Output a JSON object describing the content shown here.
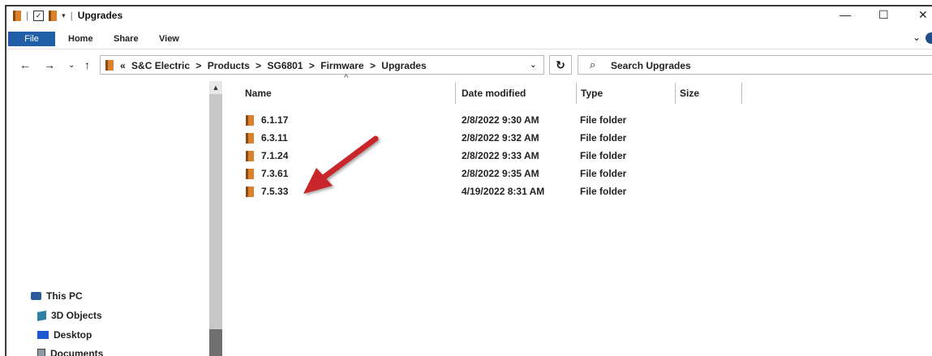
{
  "window": {
    "title": "Upgrades",
    "controls": {
      "minimize": "—",
      "maximize": "☐",
      "close": "✕"
    }
  },
  "quick_access": {
    "separator": "|",
    "dropdown": "▾",
    "check": "✓"
  },
  "ribbon": {
    "tabs": [
      {
        "label": "File"
      },
      {
        "label": "Home"
      },
      {
        "label": "Share"
      },
      {
        "label": "View"
      }
    ],
    "expand": "⌄"
  },
  "navigation": {
    "back": "←",
    "forward": "→",
    "recent": "⌄",
    "up": "↑"
  },
  "address": {
    "crumbs": [
      "«",
      "S&C Electric",
      ">",
      "Products",
      ">",
      "SG6801",
      ">",
      "Firmware",
      ">",
      "Upgrades"
    ],
    "dropdown": "⌄",
    "refresh": "↻"
  },
  "search": {
    "icon": "⌕",
    "placeholder": "Search Upgrades"
  },
  "nav_pane": {
    "items": [
      {
        "label": "This PC",
        "icon": "pc-icon"
      },
      {
        "label": "3D Objects",
        "icon": "3d-objects-icon"
      },
      {
        "label": "Desktop",
        "icon": "desktop-icon"
      },
      {
        "label": "Documents",
        "icon": "documents-icon"
      }
    ]
  },
  "scrollbar": {
    "up": "▲"
  },
  "columns": {
    "sort_indicator": "^",
    "headers": [
      "Name",
      "Date modified",
      "Type",
      "Size"
    ]
  },
  "files": [
    {
      "name": "6.1.17",
      "date": "2/8/2022 9:30 AM",
      "type": "File folder"
    },
    {
      "name": "6.3.11",
      "date": "2/8/2022 9:32 AM",
      "type": "File folder"
    },
    {
      "name": "7.1.24",
      "date": "2/8/2022 9:33 AM",
      "type": "File folder"
    },
    {
      "name": "7.3.61",
      "date": "2/8/2022 9:35 AM",
      "type": "File folder"
    },
    {
      "name": "7.5.33",
      "date": "4/19/2022 8:31 AM",
      "type": "File folder"
    }
  ],
  "colors": {
    "file_tab": "#1f5fa8",
    "folder": "#d9822b",
    "arrow": "#c8252a"
  }
}
